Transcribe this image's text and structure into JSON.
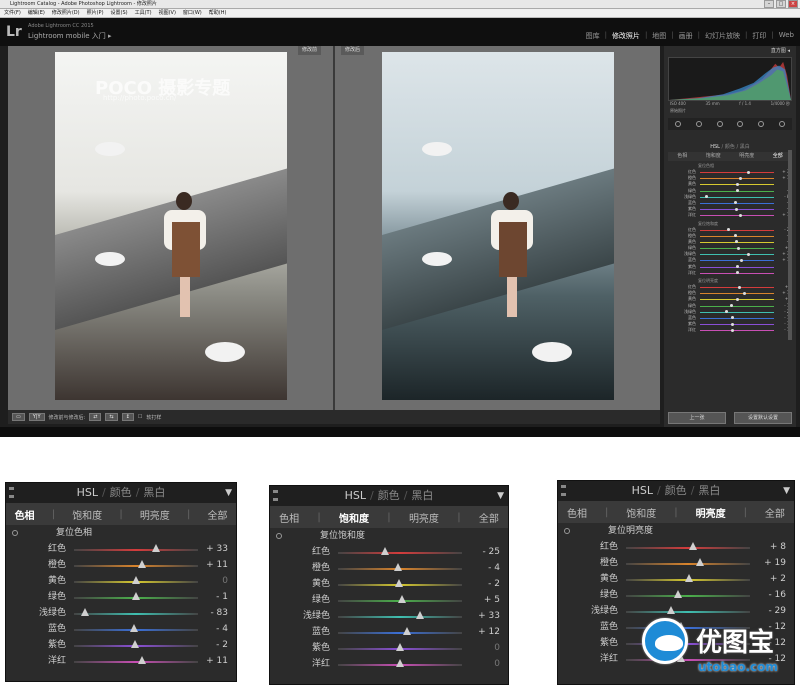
{
  "titlebar": {
    "title": "Lightroom Catalog - Adobe Photoshop Lightroom - 修改照片"
  },
  "menu": [
    "文件(F)",
    "编辑(E)",
    "修改照片(D)",
    "照片(P)",
    "设置(S)",
    "工具(T)",
    "视图(V)",
    "窗口(W)",
    "帮助(H)"
  ],
  "identity": {
    "logo": "Lr",
    "catalog": "Adobe Lightroom CC 2015",
    "mobile": "Lightroom mobile 入门 ▸"
  },
  "modules": [
    {
      "label": "图库"
    },
    {
      "label": "修改照片",
      "active": true
    },
    {
      "label": "地图"
    },
    {
      "label": "画册"
    },
    {
      "label": "幻灯片放映"
    },
    {
      "label": "打印"
    },
    {
      "label": "Web"
    }
  ],
  "view": {
    "before_label": "修改前",
    "after_label": "修改后",
    "watermark": "POCO 摄影专题",
    "watermark_url": "http://photo.poco.cn/"
  },
  "toolbar": {
    "yy": "Y|Y",
    "mode": "修改前与修改后:",
    "softproof": "软打样"
  },
  "histogram": {
    "title": "直方图",
    "info": [
      "ISO 400",
      "35 mm",
      "f / 1.4",
      "1/4000 秒"
    ],
    "original": "原始照片"
  },
  "mini_hsl": {
    "header": {
      "hsl": "HSL",
      "color": "颜色",
      "bw": "黑白"
    },
    "tabs": [
      "色相",
      "饱和度",
      "明亮度",
      "全部"
    ],
    "groups": [
      {
        "title": "复位色相",
        "rows": [
          {
            "label": "红色",
            "value": "+ 33",
            "pos": 0.66
          },
          {
            "label": "橙色",
            "value": "+ 11",
            "pos": 0.55
          },
          {
            "label": "黄色",
            "value": "0",
            "pos": 0.5
          },
          {
            "label": "绿色",
            "value": "- 1",
            "pos": 0.5
          },
          {
            "label": "浅绿色",
            "value": "- 83",
            "pos": 0.09
          },
          {
            "label": "蓝色",
            "value": "- 4",
            "pos": 0.48
          },
          {
            "label": "紫色",
            "value": "- 2",
            "pos": 0.49
          },
          {
            "label": "洋红",
            "value": "+ 11",
            "pos": 0.55
          }
        ]
      },
      {
        "title": "复位饱和度",
        "rows": [
          {
            "label": "红色",
            "value": "- 25",
            "pos": 0.38
          },
          {
            "label": "橙色",
            "value": "- 4",
            "pos": 0.48
          },
          {
            "label": "黄色",
            "value": "- 2",
            "pos": 0.49
          },
          {
            "label": "绿色",
            "value": "+ 5",
            "pos": 0.52
          },
          {
            "label": "浅绿色",
            "value": "+ 33",
            "pos": 0.66
          },
          {
            "label": "蓝色",
            "value": "+ 12",
            "pos": 0.56
          },
          {
            "label": "紫色",
            "value": "0",
            "pos": 0.5
          },
          {
            "label": "洋红",
            "value": "0",
            "pos": 0.5
          }
        ]
      },
      {
        "title": "复位明亮度",
        "rows": [
          {
            "label": "红色",
            "value": "+ 8",
            "pos": 0.54
          },
          {
            "label": "橙色",
            "value": "+ 19",
            "pos": 0.6
          },
          {
            "label": "黄色",
            "value": "+ 2",
            "pos": 0.51
          },
          {
            "label": "绿色",
            "value": "- 16",
            "pos": 0.42
          },
          {
            "label": "浅绿色",
            "value": "- 29",
            "pos": 0.36
          },
          {
            "label": "蓝色",
            "value": "- 12",
            "pos": 0.44
          },
          {
            "label": "紫色",
            "value": "- 12",
            "pos": 0.44
          },
          {
            "label": "洋红",
            "value": "- 12",
            "pos": 0.44
          }
        ]
      }
    ]
  },
  "right_buttons": {
    "prev": "上一张",
    "reset": "设置默认设置"
  },
  "panels": [
    {
      "header": {
        "hsl": "HSL",
        "color": "颜色",
        "bw": "黑白"
      },
      "tabs": [
        "色相",
        "饱和度",
        "明亮度",
        "全部"
      ],
      "active_tab": 0,
      "title": "复位色相",
      "rows": [
        {
          "label": "红色",
          "value": "+ 33",
          "pos": 0.66
        },
        {
          "label": "橙色",
          "value": "+ 11",
          "pos": 0.55
        },
        {
          "label": "黄色",
          "value": "0",
          "pos": 0.5
        },
        {
          "label": "绿色",
          "value": "- 1",
          "pos": 0.5
        },
        {
          "label": "浅绿色",
          "value": "- 83",
          "pos": 0.09
        },
        {
          "label": "蓝色",
          "value": "- 4",
          "pos": 0.48
        },
        {
          "label": "紫色",
          "value": "- 2",
          "pos": 0.49
        },
        {
          "label": "洋红",
          "value": "+ 11",
          "pos": 0.55
        }
      ]
    },
    {
      "header": {
        "hsl": "HSL",
        "color": "颜色",
        "bw": "黑白"
      },
      "tabs": [
        "色相",
        "饱和度",
        "明亮度",
        "全部"
      ],
      "active_tab": 1,
      "title": "复位饱和度",
      "rows": [
        {
          "label": "红色",
          "value": "- 25",
          "pos": 0.38
        },
        {
          "label": "橙色",
          "value": "- 4",
          "pos": 0.48
        },
        {
          "label": "黄色",
          "value": "- 2",
          "pos": 0.49
        },
        {
          "label": "绿色",
          "value": "+ 5",
          "pos": 0.52
        },
        {
          "label": "浅绿色",
          "value": "+ 33",
          "pos": 0.66
        },
        {
          "label": "蓝色",
          "value": "+ 12",
          "pos": 0.56
        },
        {
          "label": "紫色",
          "value": "0",
          "pos": 0.5
        },
        {
          "label": "洋红",
          "value": "0",
          "pos": 0.5
        }
      ]
    },
    {
      "header": {
        "hsl": "HSL",
        "color": "颜色",
        "bw": "黑白"
      },
      "tabs": [
        "色相",
        "饱和度",
        "明亮度",
        "全部"
      ],
      "active_tab": 2,
      "title": "复位明亮度",
      "rows": [
        {
          "label": "红色",
          "value": "+ 8",
          "pos": 0.54
        },
        {
          "label": "橙色",
          "value": "+ 19",
          "pos": 0.6
        },
        {
          "label": "黄色",
          "value": "+ 2",
          "pos": 0.51
        },
        {
          "label": "绿色",
          "value": "- 16",
          "pos": 0.42
        },
        {
          "label": "浅绿色",
          "value": "- 29",
          "pos": 0.36
        },
        {
          "label": "蓝色",
          "value": "- 12",
          "pos": 0.44
        },
        {
          "label": "紫色",
          "value": "- 12",
          "pos": 0.44
        },
        {
          "label": "洋红",
          "value": "- 12",
          "pos": 0.44
        }
      ]
    }
  ],
  "logo": {
    "text": "优图宝",
    "url": "utobao.com"
  },
  "track_colors": [
    "#d43c3c",
    "#d9842c",
    "#d6c930",
    "#4bb04b",
    "#3fbfb0",
    "#3b6fd6",
    "#8a4fd6",
    "#c84fb4"
  ]
}
